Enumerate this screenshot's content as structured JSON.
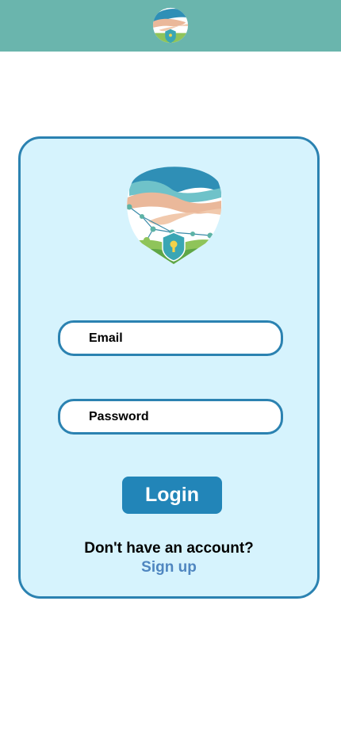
{
  "header": {
    "logo_icon": "hands-shield-logo-icon",
    "background_color": "#6ab5ad"
  },
  "login_card": {
    "logo_icon": "hands-shield-logo-icon",
    "email_placeholder": "Email",
    "password_placeholder": "Password",
    "login_label": "Login",
    "no_account_text": "Don't have an account?",
    "signup_label": "Sign up"
  },
  "colors": {
    "card_background": "#d6f3fd",
    "accent": "#2b82b1",
    "button": "#2285b8",
    "link": "#4f86c0"
  }
}
